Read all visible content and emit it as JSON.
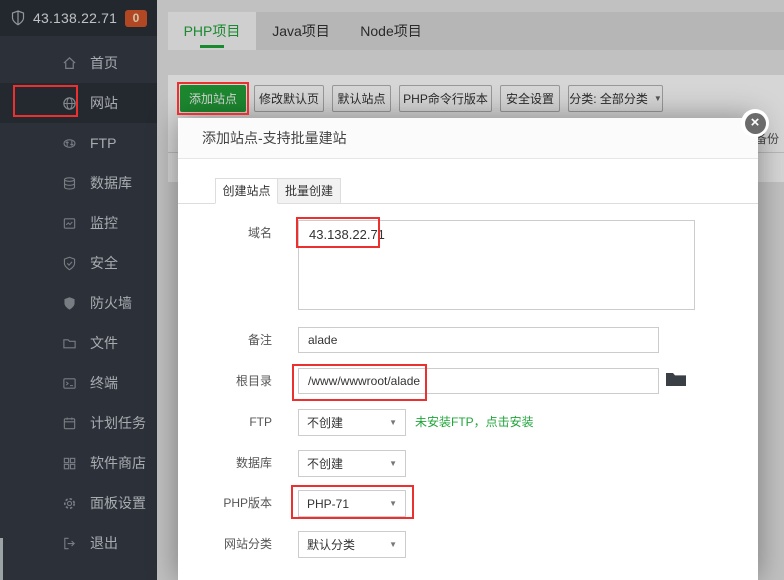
{
  "sidebar": {
    "server_ip": "43.138.22.71",
    "badge_count": "0",
    "items": [
      {
        "label": "首页"
      },
      {
        "label": "网站"
      },
      {
        "label": "FTP"
      },
      {
        "label": "数据库"
      },
      {
        "label": "监控"
      },
      {
        "label": "安全"
      },
      {
        "label": "防火墙"
      },
      {
        "label": "文件"
      },
      {
        "label": "终端"
      },
      {
        "label": "计划任务"
      },
      {
        "label": "软件商店"
      },
      {
        "label": "面板设置"
      },
      {
        "label": "退出"
      }
    ]
  },
  "tabs": {
    "items": [
      {
        "label": "PHP项目",
        "active": true
      },
      {
        "label": "Java项目",
        "active": false
      },
      {
        "label": "Node项目",
        "active": false
      }
    ]
  },
  "toolbar": {
    "add_site": "添加站点",
    "modify_default_page": "修改默认页",
    "default_site": "默认站点",
    "php_cli_version": "PHP命令行版本",
    "security_settings": "安全设置",
    "category_filter": "分类: 全部分类"
  },
  "background_table": {
    "backup_header": "备份"
  },
  "modal": {
    "title": "添加站点-支持批量建站",
    "tabs": [
      {
        "label": "创建站点",
        "active": true
      },
      {
        "label": "批量创建",
        "active": false
      }
    ],
    "form": {
      "domain_label": "域名",
      "domain_value": "43.138.22.71",
      "note_label": "备注",
      "note_value": "alade",
      "root_label": "根目录",
      "root_value": "/www/wwwroot/alade",
      "ftp_label": "FTP",
      "ftp_value": "不创建",
      "ftp_hint": "未安装FTP，点击安装",
      "db_label": "数据库",
      "db_value": "不创建",
      "php_label": "PHP版本",
      "php_value": "PHP-71",
      "category_label": "网站分类",
      "category_value": "默认分类"
    }
  },
  "icons": {
    "close_glyph": "×",
    "dropdown_glyph": "▼"
  },
  "colors": {
    "accent_green": "#20a53a",
    "annotation_red": "#ec2f2f",
    "badge_orange": "#d4562a"
  }
}
